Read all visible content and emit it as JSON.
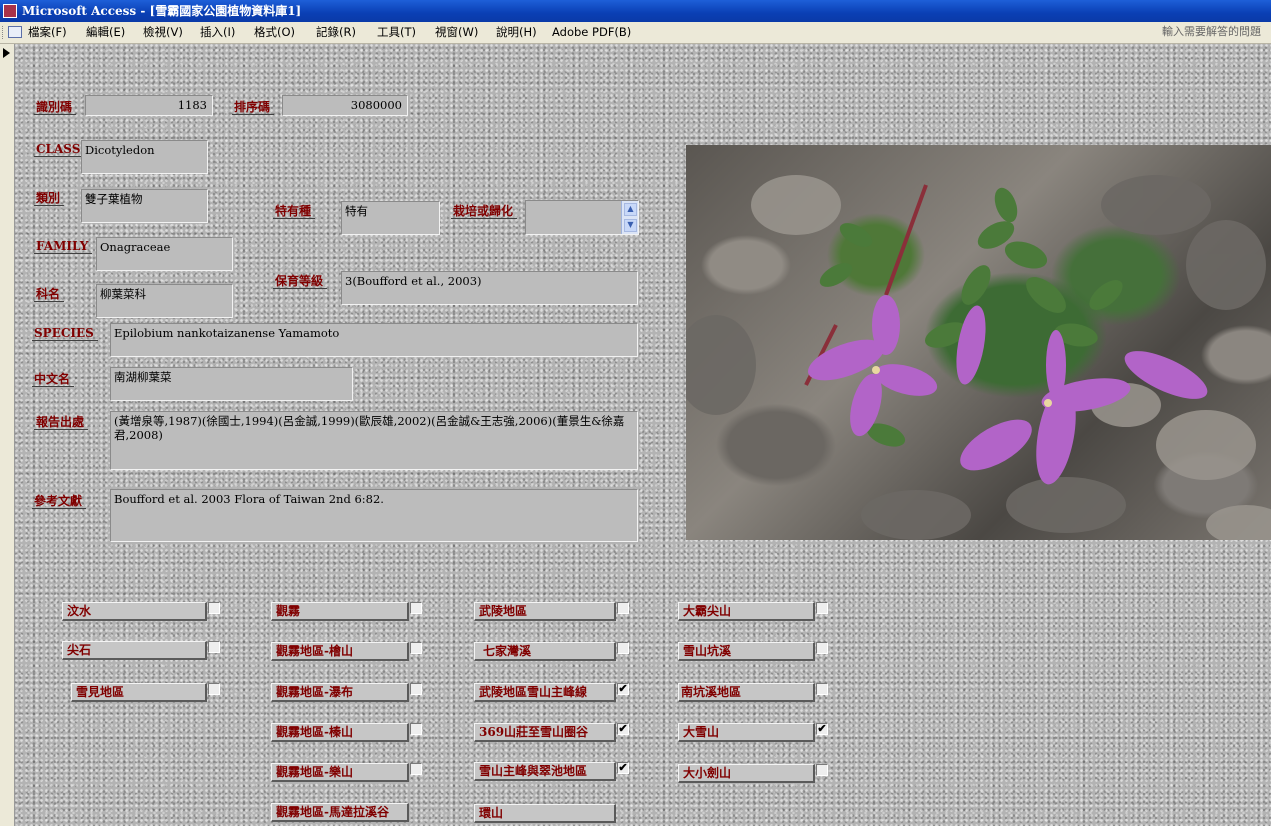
{
  "window": {
    "title": "Microsoft Access - [雪霸國家公園植物資料庫1]"
  },
  "menubar": {
    "items": [
      "檔案(F)",
      "編輯(E)",
      "檢視(V)",
      "插入(I)",
      "格式(O)",
      "記錄(R)",
      "工具(T)",
      "視窗(W)",
      "說明(H)",
      "Adobe PDF(B)"
    ],
    "help_placeholder": "輸入需要解答的問題"
  },
  "form": {
    "id_label": "識別碼",
    "id_value": "1183",
    "sort_label": "排序碼",
    "sort_value": "3080000",
    "class_label": "CLASS",
    "class_value": "Dicotyledon",
    "category_label": "類別",
    "category_value": "雙子葉植物",
    "endemic_label": "特有種",
    "endemic_value": "特有",
    "cultivated_label": "栽培或歸化",
    "cultivated_value": "",
    "family_label": "FAMILY",
    "family_value": "Onagraceae",
    "conservation_label": "保育等級",
    "conservation_value": "3(Boufford et al., 2003)",
    "family_cn_label": "科名",
    "family_cn_value": "柳葉菜科",
    "species_label": "SPECIES",
    "species_value": "Epilobium nankotaizanense Yamamoto",
    "chinese_name_label": "中文名",
    "chinese_name_value": "南湖柳葉菜",
    "report_source_label": "報告出處",
    "report_source_value": "(黃增泉等,1987)(徐國士,1994)(呂金誠,1999)(歐辰雄,2002)(呂金誠&王志強,2006)(董景生&徐嘉君,2008)",
    "reference_label": "參考文獻",
    "reference_value": "Boufford et al. 2003 Flora of Taiwan 2nd 6:82."
  },
  "locations": [
    {
      "label": "汶水",
      "checked": false
    },
    {
      "label": "尖石",
      "checked": false
    },
    {
      "label": "雪見地區",
      "checked": false
    },
    {
      "label": "觀霧",
      "checked": false
    },
    {
      "label": "觀霧地區-檜山",
      "checked": false
    },
    {
      "label": "觀霧地區-瀑布",
      "checked": false
    },
    {
      "label": "觀霧地區-榛山",
      "checked": false
    },
    {
      "label": "觀霧地區-樂山",
      "checked": false
    },
    {
      "label": "觀霧地區-馬達拉溪谷",
      "checked": false
    },
    {
      "label": "武陵地區",
      "checked": false
    },
    {
      "label": "七家灣溪",
      "checked": false
    },
    {
      "label": "武陵地區雪山主峰線",
      "checked": true
    },
    {
      "label": "369山莊至雪山圈谷",
      "checked": true
    },
    {
      "label": "雪山主峰與翠池地區",
      "checked": true
    },
    {
      "label": "環山",
      "checked": false
    },
    {
      "label": "大霸尖山",
      "checked": false
    },
    {
      "label": "雪山坑溪",
      "checked": false
    },
    {
      "label": "南坑溪地區",
      "checked": false
    },
    {
      "label": "大雪山",
      "checked": true
    },
    {
      "label": "大小劍山",
      "checked": false
    }
  ],
  "colors": {
    "label_text": "#800000",
    "titlebar": "#0a3fb4"
  }
}
